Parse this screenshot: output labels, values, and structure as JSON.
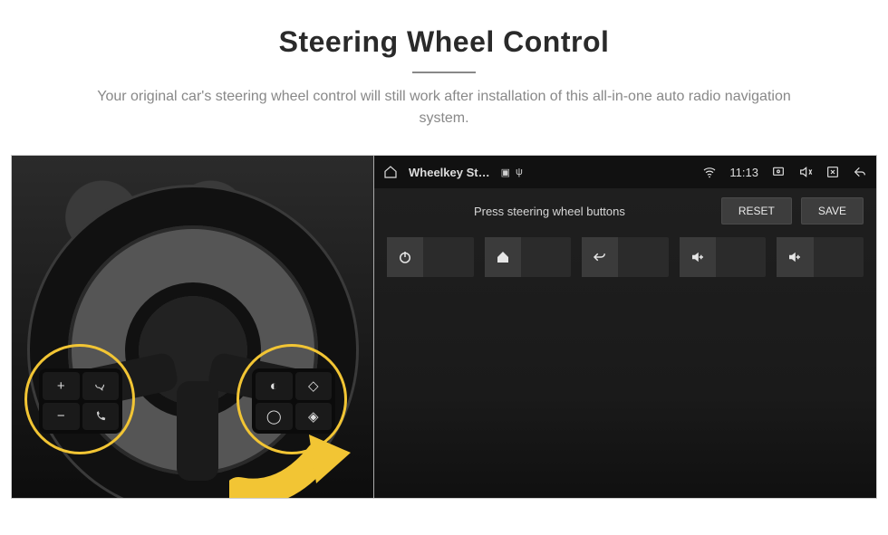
{
  "header": {
    "title": "Steering Wheel Control",
    "subtitle": "Your original car's steering wheel control will still work after installation of this all-in-one auto radio navigation system."
  },
  "wheel": {
    "left_cluster": [
      "+",
      "voice",
      "−",
      "phone"
    ],
    "right_cluster": [
      "media",
      "up",
      "cycle",
      "down"
    ]
  },
  "statusbar": {
    "app_title": "Wheelkey St…",
    "indicators": [
      "image",
      "usb"
    ],
    "time": "11:13",
    "right_icons": [
      "wifi",
      "screenshot",
      "mute",
      "close",
      "back"
    ]
  },
  "panel": {
    "instruction": "Press steering wheel buttons",
    "reset_label": "RESET",
    "save_label": "SAVE",
    "slots": [
      {
        "icon": "power",
        "value": ""
      },
      {
        "icon": "home",
        "value": ""
      },
      {
        "icon": "return",
        "value": ""
      },
      {
        "icon": "volup",
        "value": ""
      },
      {
        "icon": "volup",
        "value": ""
      }
    ]
  },
  "colors": {
    "accent": "#f2c534"
  }
}
